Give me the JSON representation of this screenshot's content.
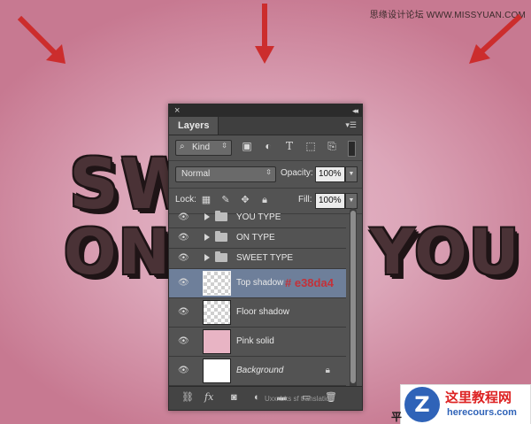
{
  "watermark": "思缘设计论坛 WWW.MISSYUAN.COM",
  "background_text": [
    "SWEET",
    "ON",
    "YOU"
  ],
  "colors": {
    "background": "#dca6b9",
    "text_fill": "#4a3236",
    "arrow": "#cc2d2d",
    "panel": "#535353",
    "selected_layer": "#6e7f9a",
    "annotation": "#c2323a",
    "pink_solid": "#e38da4"
  },
  "panel": {
    "close_label": "×",
    "collapse_label": "◂◂",
    "tab_label": "Layers",
    "menu_icon": "panel-menu-icon",
    "filter": {
      "kind_label": "Kind",
      "icons": [
        "image-filter-icon",
        "adjustment-filter-icon",
        "type-filter-icon",
        "shape-filter-icon",
        "smart-object-filter-icon"
      ]
    },
    "blend_mode": "Normal",
    "opacity_label": "Opacity:",
    "opacity_value": "100%",
    "lock_label": "Lock:",
    "fill_label": "Fill:",
    "fill_value": "100%",
    "layers": [
      {
        "name": "YOU TYPE",
        "type": "group"
      },
      {
        "name": "ON TYPE",
        "type": "group"
      },
      {
        "name": "SWEET TYPE",
        "type": "group"
      },
      {
        "name": "Top shadow",
        "type": "layer",
        "selected": true
      },
      {
        "name": "Floor shadow",
        "type": "layer"
      },
      {
        "name": "Pink solid",
        "type": "fill"
      },
      {
        "name": "Background",
        "type": "background",
        "locked": true
      }
    ],
    "annotation": "# e38da4",
    "bottom_caption": "Uxxxbks sf translation"
  },
  "logo": {
    "cn": "这里教程网",
    "en": "herecours.com",
    "mark": "Z"
  },
  "corner_text": "平"
}
